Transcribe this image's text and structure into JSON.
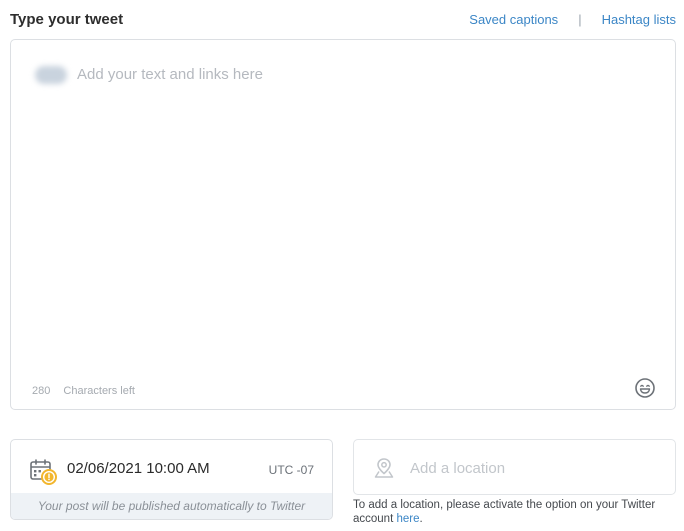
{
  "header": {
    "title": "Type your tweet",
    "saved_captions": "Saved captions",
    "separator": "|",
    "hashtag_lists": "Hashtag lists"
  },
  "editor": {
    "placeholder": "Add your text and links here",
    "chars_left_count": "280",
    "chars_left_label": "Characters left",
    "emoji_icon": "smiley-icon"
  },
  "schedule": {
    "date": "02/06/2021",
    "time": "10:00 AM",
    "timezone": "UTC -07",
    "auto_publish_note": "Your post will be published automatically to Twitter",
    "icon": "calendar-clock-icon"
  },
  "location": {
    "placeholder": "Add a location",
    "icon": "location-pin-icon",
    "note_text": "To add a location, please activate the option on your Twitter account ",
    "note_link": "here",
    "note_end": "."
  },
  "colors": {
    "link": "#3b86c6",
    "border": "#dcdfe3",
    "note_bg": "#eef2f6",
    "calendar_accent": "#f2b62e"
  }
}
